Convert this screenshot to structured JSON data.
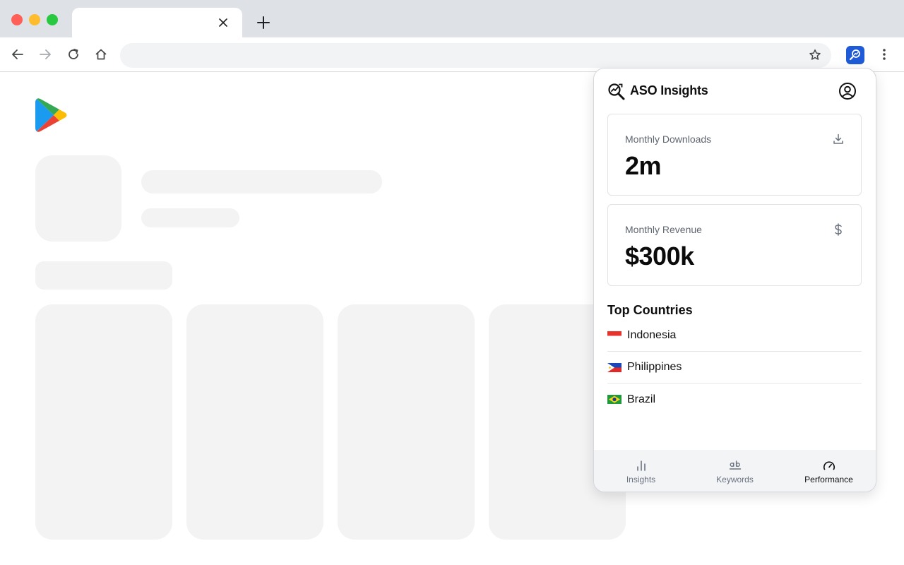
{
  "browser": {
    "address_value": "",
    "icons": {
      "tab_close": "close-icon",
      "new_tab": "plus-icon",
      "back": "arrow-left-icon",
      "forward": "arrow-right-icon",
      "reload": "reload-icon",
      "home": "home-icon",
      "bookmark": "star-icon",
      "extension": "aso-extension-icon",
      "menu": "kebab-menu-icon"
    }
  },
  "popup": {
    "title": "ASO Insights",
    "stats": [
      {
        "label": "Monthly Downloads",
        "value": "2m",
        "icon": "download-icon"
      },
      {
        "label": "Monthly Revenue",
        "value": "$300k",
        "icon": "dollar-icon"
      }
    ],
    "top_countries": {
      "title": "Top Countries",
      "items": [
        {
          "name": "Indonesia",
          "flag": "indonesia-flag-icon"
        },
        {
          "name": "Philippines",
          "flag": "philippines-flag-icon"
        },
        {
          "name": "Brazil",
          "flag": "brazil-flag-icon"
        }
      ]
    },
    "nav": [
      {
        "label": "Insights",
        "icon": "bar-chart-icon",
        "active": false
      },
      {
        "label": "Keywords",
        "icon": "keywords-icon",
        "active": false
      },
      {
        "label": "Performance",
        "icon": "gauge-icon",
        "active": true
      }
    ]
  },
  "colors": {
    "accent": "#1f5bd6",
    "tabstrip": "#dee1e6",
    "skeleton": "#f3f3f4",
    "nav_bg": "#f3f4f6"
  }
}
